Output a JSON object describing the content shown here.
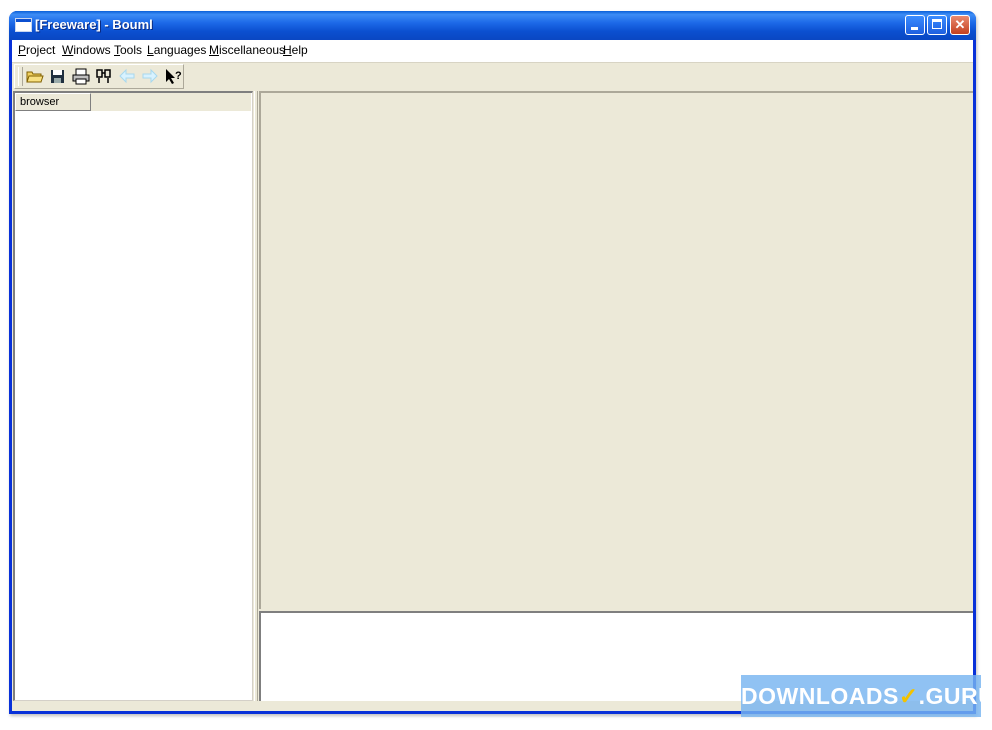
{
  "window": {
    "title": "[Freeware] - Bouml",
    "controls": {
      "minimize": "minimize",
      "maximize": "maximize",
      "close": "✕"
    }
  },
  "menubar": {
    "items": [
      {
        "label": "Project",
        "accel": "P",
        "rest": "roject"
      },
      {
        "label": "Windows",
        "accel": "W",
        "rest": "indows"
      },
      {
        "label": "Tools",
        "accel": "T",
        "rest": "ools"
      },
      {
        "label": "Languages",
        "accel": "L",
        "rest": "anguages"
      },
      {
        "label": "Miscellaneous",
        "accel": "M",
        "rest": "iscellaneous"
      },
      {
        "label": "Help",
        "accel": "H",
        "rest": "elp"
      }
    ]
  },
  "toolbar": {
    "tools": [
      {
        "icon": "open-folder-icon",
        "glyph": "📂",
        "enabled": true
      },
      {
        "icon": "save-icon",
        "glyph": "💾",
        "enabled": true
      },
      {
        "icon": "print-icon",
        "glyph": "🖨",
        "enabled": true
      },
      {
        "icon": "find-icon",
        "glyph": "⌘",
        "enabled": true
      },
      {
        "icon": "back-arrow-icon",
        "glyph": "⇦",
        "enabled": false
      },
      {
        "icon": "forward-arrow-icon",
        "glyph": "⇨",
        "enabled": false
      },
      {
        "icon": "whats-this-help-icon",
        "glyph": "?",
        "enabled": true
      }
    ]
  },
  "browser": {
    "header": "browser"
  },
  "watermark": {
    "left": "DOWNLOADS",
    "right": ".GURU"
  },
  "colors": {
    "title_bar": "#0b4fd0",
    "client_bg": "#ece9d8",
    "panel_bg": "#ffffff"
  }
}
